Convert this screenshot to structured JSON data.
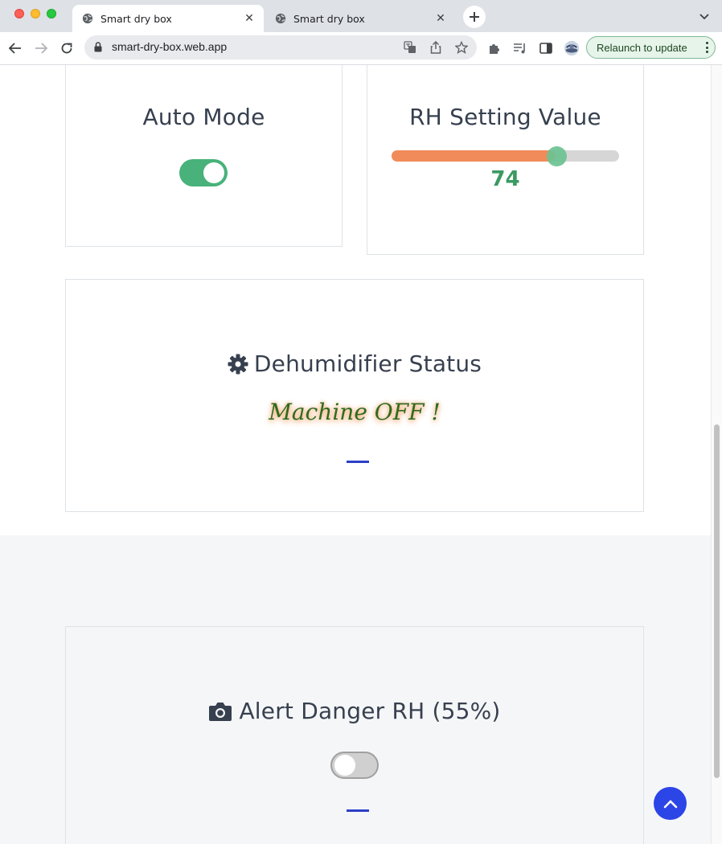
{
  "browser": {
    "tabs": [
      {
        "title": "Smart dry box",
        "active": true
      },
      {
        "title": "Smart dry box",
        "active": false
      }
    ],
    "url": "smart-dry-box.web.app",
    "relaunch_label": "Relaunch to update"
  },
  "auto_mode": {
    "title": "Auto Mode",
    "enabled": true
  },
  "rh_setting": {
    "title": "RH Setting Value",
    "value": "74",
    "slider_fraction": 0.72
  },
  "dehumidifier": {
    "title": "Dehumidifier Status",
    "icon": "gear-icon",
    "status_text": "Machine OFF !"
  },
  "alert": {
    "title": "Alert Danger RH (55%)",
    "icon": "camera-icon",
    "enabled": false
  },
  "colors": {
    "toggle_on": "#48b27a",
    "slider_fill": "#f28b5a",
    "accent_blue": "#2c45e6",
    "title_text": "#37404f"
  }
}
